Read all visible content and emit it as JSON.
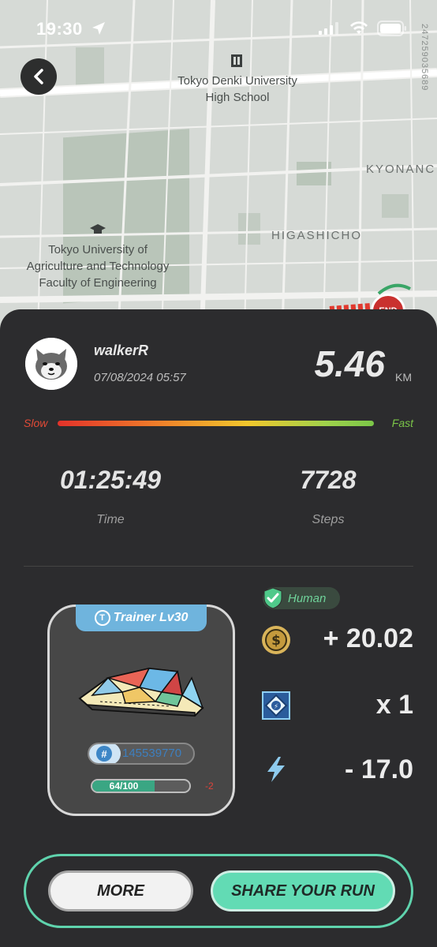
{
  "status_bar": {
    "time": "19:30"
  },
  "map": {
    "poi": [
      {
        "name": "Tokyo Denki University\nHigh School"
      },
      {
        "name": "Tokyo University of\nAgriculture and Technology\nFaculty of Engineering"
      }
    ],
    "areas": [
      "KYONANC",
      "HIGASHICHO"
    ],
    "vertical_id": "247259035689",
    "end_marker": "END"
  },
  "run": {
    "username": "walkerR",
    "datetime": "07/08/2024 05:57",
    "distance": "5.46",
    "distance_unit": "KM",
    "speed_slow_label": "Slow",
    "speed_fast_label": "Fast",
    "time_value": "01:25:49",
    "time_label": "Time",
    "steps_value": "7728",
    "steps_label": "Steps"
  },
  "sneaker": {
    "trainer_icon": "T",
    "trainer_label": "Trainer Lv30",
    "id_symbol": "#",
    "id": "145539770",
    "durability_text": "64/100",
    "durability_fraction": 0.64,
    "durability_delta": "-2"
  },
  "rewards": {
    "badge": "Human",
    "gst": "+ 20.02",
    "mystery_box": "x 1",
    "energy": "- 17.0"
  },
  "buttons": {
    "more": "MORE",
    "share": "SHARE YOUR RUN"
  },
  "colors": {
    "accent": "#62dbb4",
    "card_bg": "#2c2c2e",
    "trainer_tab": "#6fb4dd",
    "human_badge_text": "#6fd39a",
    "slow": "#e24a36",
    "fast": "#7bc648"
  }
}
